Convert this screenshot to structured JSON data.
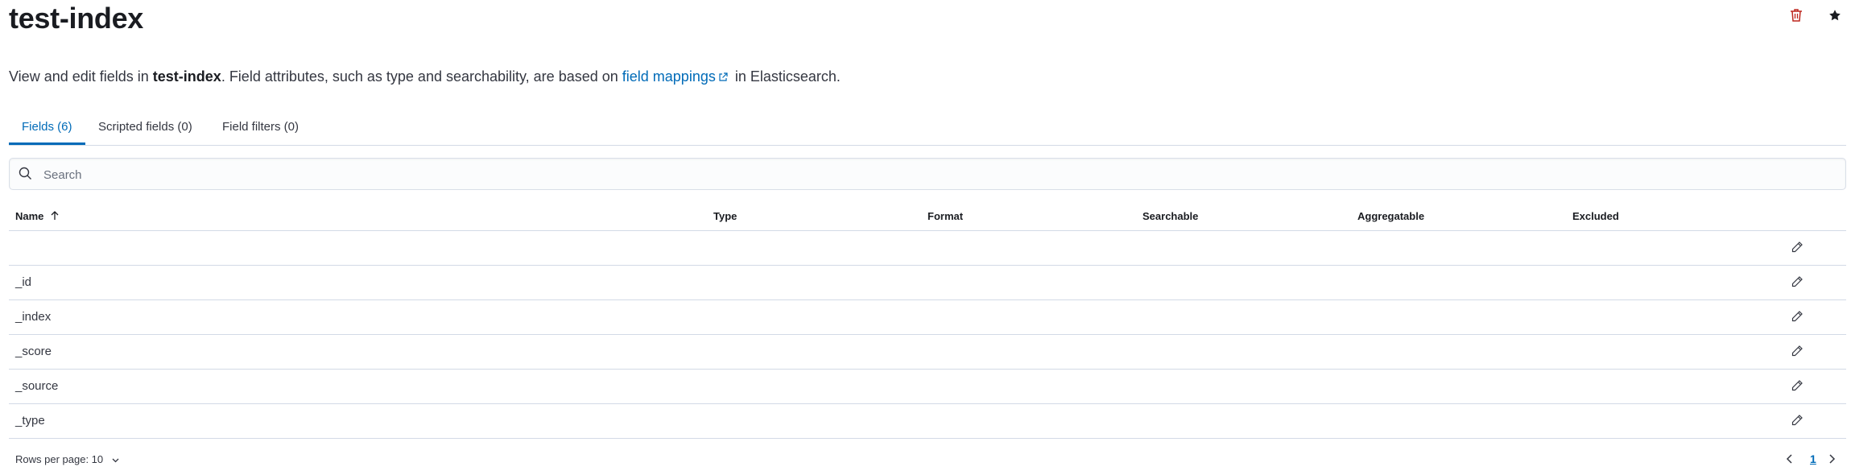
{
  "header": {
    "title": "test-index",
    "delete_icon": "trash-icon",
    "default_icon": "star-icon",
    "colors": {
      "danger": "#bd271e",
      "accent": "#006bb8"
    }
  },
  "description": {
    "prefix": "View and edit fields in ",
    "index_name": "test-index",
    "middle": ". Field attributes, such as type and searchability, are based on ",
    "link_text": "field mappings",
    "link_icon": "external-link-icon",
    "suffix": " in Elasticsearch."
  },
  "tabs": [
    {
      "label": "Fields (6)",
      "active": true
    },
    {
      "label": "Scripted fields (0)",
      "active": false
    },
    {
      "label": "Field filters (0)",
      "active": false
    }
  ],
  "search": {
    "placeholder": "Search",
    "value": "",
    "icon": "search-icon"
  },
  "table": {
    "columns": [
      "Name",
      "Type",
      "Format",
      "Searchable",
      "Aggregatable",
      "Excluded"
    ],
    "sort_icon": "arrow-up-icon",
    "rows": [
      {
        "name": ""
      },
      {
        "name": "_id"
      },
      {
        "name": "_index"
      },
      {
        "name": "_score"
      },
      {
        "name": "_source"
      },
      {
        "name": "_type"
      }
    ],
    "edit_icon": "pencil-icon"
  },
  "pagination": {
    "rows_per_page_label": "Rows per page: 10",
    "current_page": "1",
    "prev_icon": "chevron-left-icon",
    "next_icon": "chevron-right-icon"
  }
}
